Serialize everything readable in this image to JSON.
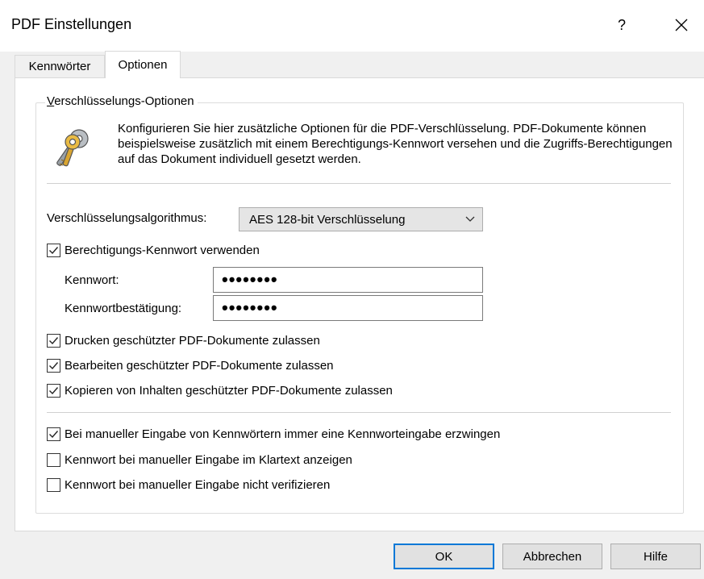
{
  "window": {
    "title": "PDF Einstellungen",
    "help_label": "?",
    "close_label": "close"
  },
  "tabs": [
    {
      "label": "Kennwörter",
      "active": false
    },
    {
      "label": "Optionen",
      "active": true
    }
  ],
  "group": {
    "label_underlined": "V",
    "label_rest": "erschlüsselungs-Optionen",
    "icon": "keys-icon",
    "description": "Konfigurieren Sie hier zusätzliche Optionen für die PDF-Verschlüsselung.  PDF-Dokumente können beispielsweise zusätzlich mit einem Berechtigungs-Kennwort versehen und die Zugriffs-Berechtigungen auf das Dokument individuell gesetzt werden."
  },
  "algorithm": {
    "label": "Verschlüsselungsalgorithmus:",
    "value": "AES 128-bit Verschlüsselung"
  },
  "permission_password": {
    "checkbox_label": "Berechtigungs-Kennwort verwenden",
    "checked": true,
    "password_label": "Kennwort:",
    "password_value": "••••••••",
    "confirm_label": "Kennwortbestätigung:",
    "confirm_value": "••••••••"
  },
  "permissions": [
    {
      "label": "Drucken geschützter PDF-Dokumente zulassen",
      "checked": true
    },
    {
      "label": "Bearbeiten geschützter PDF-Dokumente zulassen",
      "checked": true
    },
    {
      "label": "Kopieren von Inhalten geschützter PDF-Dokumente zulassen",
      "checked": true
    }
  ],
  "manual_options": [
    {
      "label": "Bei manueller Eingabe von Kennwörtern immer eine Kennworteingabe erzwingen",
      "checked": true
    },
    {
      "label": "Kennwort bei manueller Eingabe im Klartext anzeigen",
      "checked": false
    },
    {
      "label": "Kennwort bei manueller Eingabe nicht verifizieren",
      "checked": false
    }
  ],
  "buttons": {
    "ok": "OK",
    "cancel": "Abbrechen",
    "help": "Hilfe"
  },
  "colors": {
    "default_button_border": "#0078d7",
    "dialog_background": "#f0f0f0"
  }
}
